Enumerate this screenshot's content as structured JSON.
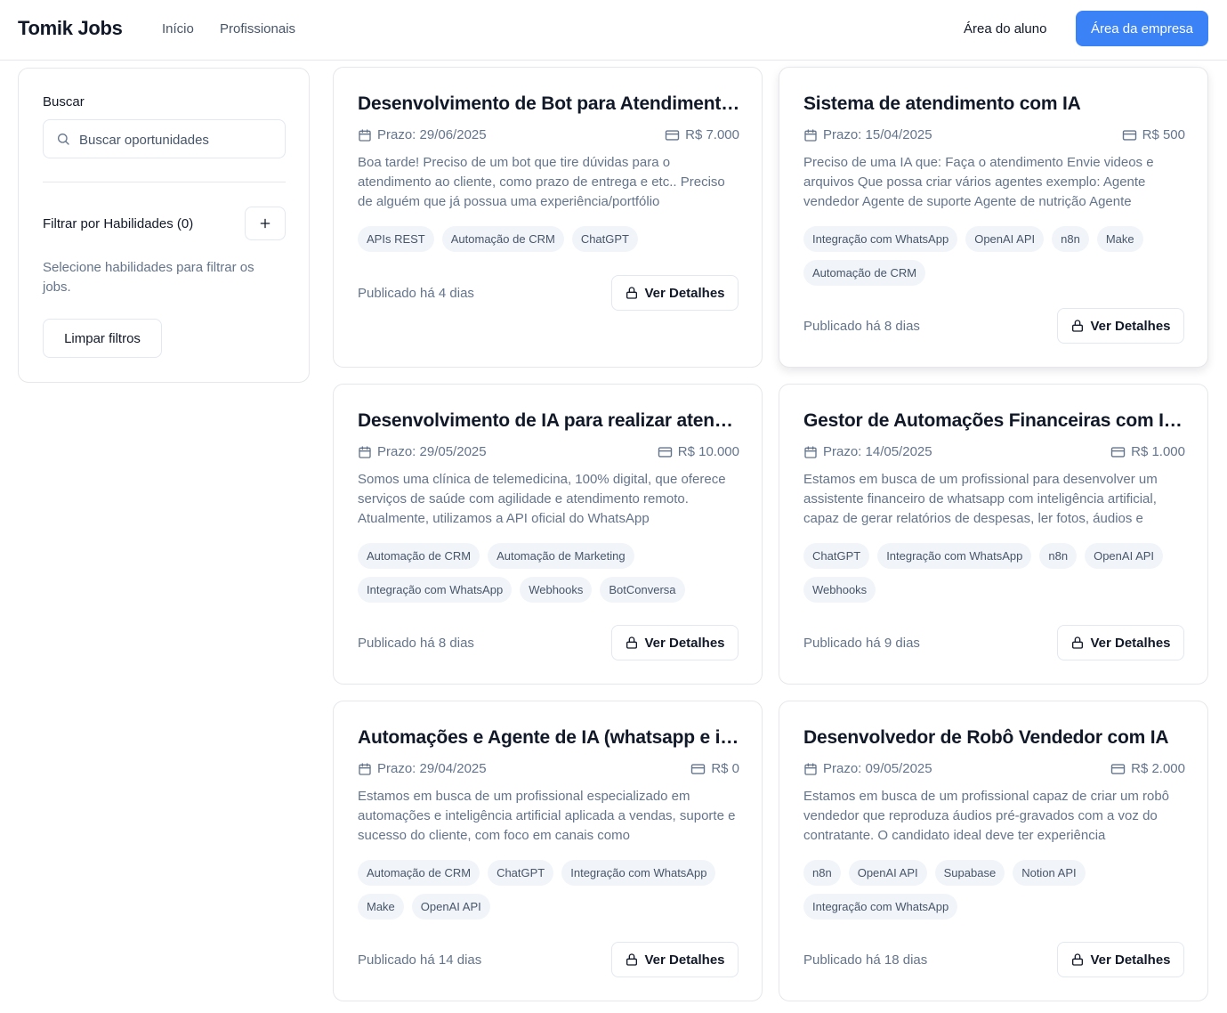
{
  "header": {
    "brand": "Tomik Jobs",
    "nav": [
      "Início",
      "Profissionais"
    ],
    "student_area": "Área do aluno",
    "company_area": "Área da empresa"
  },
  "sidebar": {
    "search_label": "Buscar",
    "search_placeholder": "Buscar oportunidades",
    "search_value": "",
    "filter_title": "Filtrar por Habilidades (0)",
    "filter_hint": "Selecione habilidades para filtrar os jobs.",
    "clear_label": "Limpar filtros"
  },
  "details_label": "Ver Detalhes",
  "jobs": [
    {
      "title": "Desenvolvimento de Bot para Atendimento ao Cliente",
      "deadline": "Prazo: 29/06/2025",
      "budget": "R$ 7.000",
      "description": "Boa tarde! Preciso de um bot que tire dúvidas para o atendimento ao cliente, como prazo de entrega e etc.. Preciso de alguém que já possua uma experiência/portfólio",
      "tags": [
        "APIs REST",
        "Automação de CRM",
        "ChatGPT"
      ],
      "published": "Publicado há 4 dias"
    },
    {
      "title": "Sistema de atendimento com IA",
      "deadline": "Prazo: 15/04/2025",
      "budget": "R$ 500",
      "description": "Preciso de uma IA que: Faça o atendimento Envie videos e arquivos Que possa criar vários agentes exemplo: Agente vendedor Agente de suporte Agente de nutrição Agente",
      "tags": [
        "Integração com WhatsApp",
        "OpenAI API",
        "n8n",
        "Make",
        "Automação de CRM"
      ],
      "published": "Publicado há 8 dias"
    },
    {
      "title": "Desenvolvimento de IA para realizar atendimentos",
      "deadline": "Prazo: 29/05/2025",
      "budget": "R$ 10.000",
      "description": "Somos uma clínica de telemedicina, 100% digital, que oferece serviços de saúde com agilidade e atendimento remoto. Atualmente, utilizamos a API oficial do WhatsApp",
      "tags": [
        "Automação de CRM",
        "Automação de Marketing",
        "Integração com WhatsApp",
        "Webhooks",
        "BotConversa"
      ],
      "published": "Publicado há 8 dias"
    },
    {
      "title": "Gestor de Automações Financeiras com IA e WhatsApp",
      "deadline": "Prazo: 14/05/2025",
      "budget": "R$ 1.000",
      "description": "Estamos em busca de um profissional para desenvolver um assistente financeiro de whatsapp com inteligência artificial, capaz de gerar relatórios de despesas, ler fotos, áudios e",
      "tags": [
        "ChatGPT",
        "Integração com WhatsApp",
        "n8n",
        "OpenAI API",
        "Webhooks"
      ],
      "published": "Publicado há 9 dias"
    },
    {
      "title": "Automações e Agente de IA (whatsapp e instagram)",
      "deadline": "Prazo: 29/04/2025",
      "budget": "R$ 0",
      "description": "Estamos em busca de um profissional especializado em automações e inteligência artificial aplicada a vendas, suporte e sucesso do cliente, com foco em canais como",
      "tags": [
        "Automação de CRM",
        "ChatGPT",
        "Integração com WhatsApp",
        "Make",
        "OpenAI API"
      ],
      "published": "Publicado há 14 dias"
    },
    {
      "title": "Desenvolvedor de Robô Vendedor com IA",
      "deadline": "Prazo: 09/05/2025",
      "budget": "R$ 2.000",
      "description": "Estamos em busca de um profissional capaz de criar um robô vendedor que reproduza áudios pré-gravados com a voz do contratante. O candidato ideal deve ter experiência",
      "tags": [
        "n8n",
        "OpenAI API",
        "Supabase",
        "Notion API",
        "Integração com WhatsApp"
      ],
      "published": "Publicado há 18 dias"
    }
  ]
}
